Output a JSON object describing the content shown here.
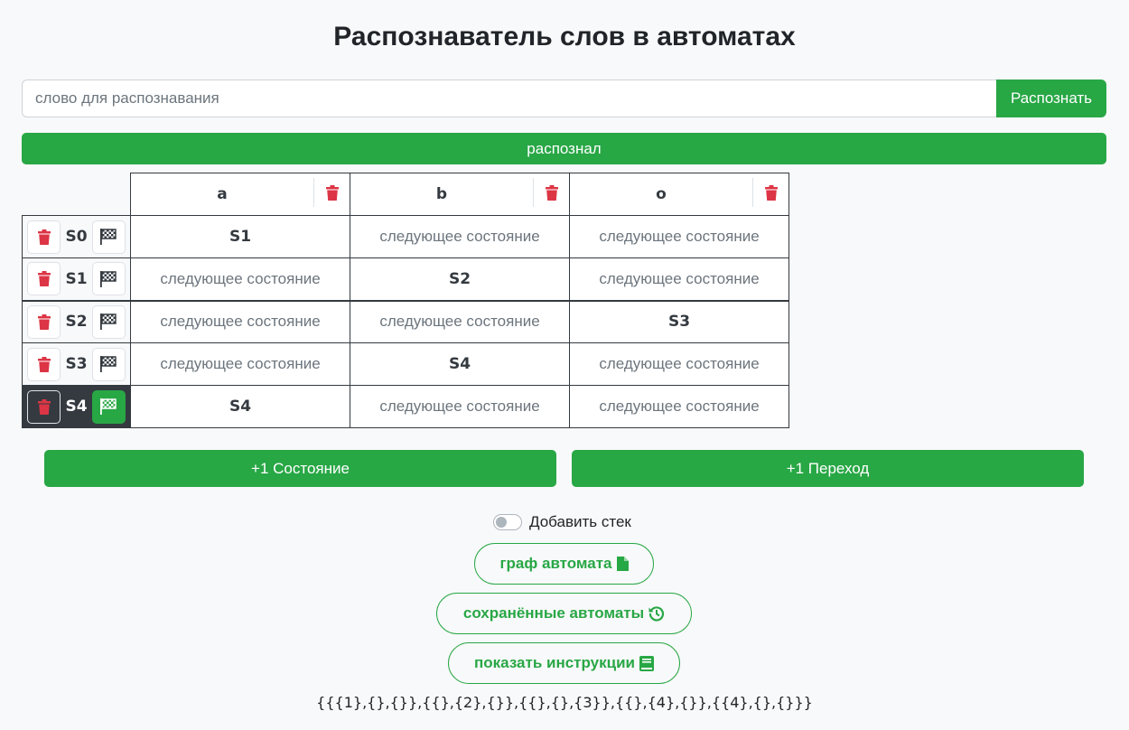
{
  "title": "Распознаватель слов в автоматах",
  "word_input": {
    "placeholder": "слово для распознавания",
    "value": ""
  },
  "recognize_button": "Распознать",
  "result": "распознал",
  "alphabet": [
    "a",
    "b",
    "o"
  ],
  "states": [
    {
      "name": "S0",
      "final": false,
      "transitions": [
        "S1",
        "",
        ""
      ]
    },
    {
      "name": "S1",
      "final": false,
      "transitions": [
        "",
        "S2",
        ""
      ]
    },
    {
      "name": "S2",
      "final": false,
      "transitions": [
        "",
        "",
        "S3"
      ]
    },
    {
      "name": "S3",
      "final": false,
      "transitions": [
        "",
        "S4",
        ""
      ]
    },
    {
      "name": "S4",
      "final": true,
      "transitions": [
        "S4",
        "",
        ""
      ]
    }
  ],
  "cell_placeholder": "следующее состояние",
  "add_state_button": "+1 Состояние",
  "add_transition_button": "+1 Переход",
  "stack_toggle": {
    "label": "Добавить стек",
    "checked": false
  },
  "graph_button": "граф автомата",
  "saved_button": "сохранённые автоматы",
  "instructions_button": "показать инструкции",
  "encoding": "{{{1},{},{}},{{},{2},{}},{{},{},{3}},{{},{4},{}},{{4},{},{}}}",
  "colors": {
    "accent": "#28a745",
    "danger": "#dc3545",
    "dark": "#343a40"
  },
  "icons": {
    "delete": "trash-icon",
    "final": "checkered-flag-icon",
    "graph": "file-icon",
    "saved": "history-icon",
    "instructions": "book-icon"
  }
}
